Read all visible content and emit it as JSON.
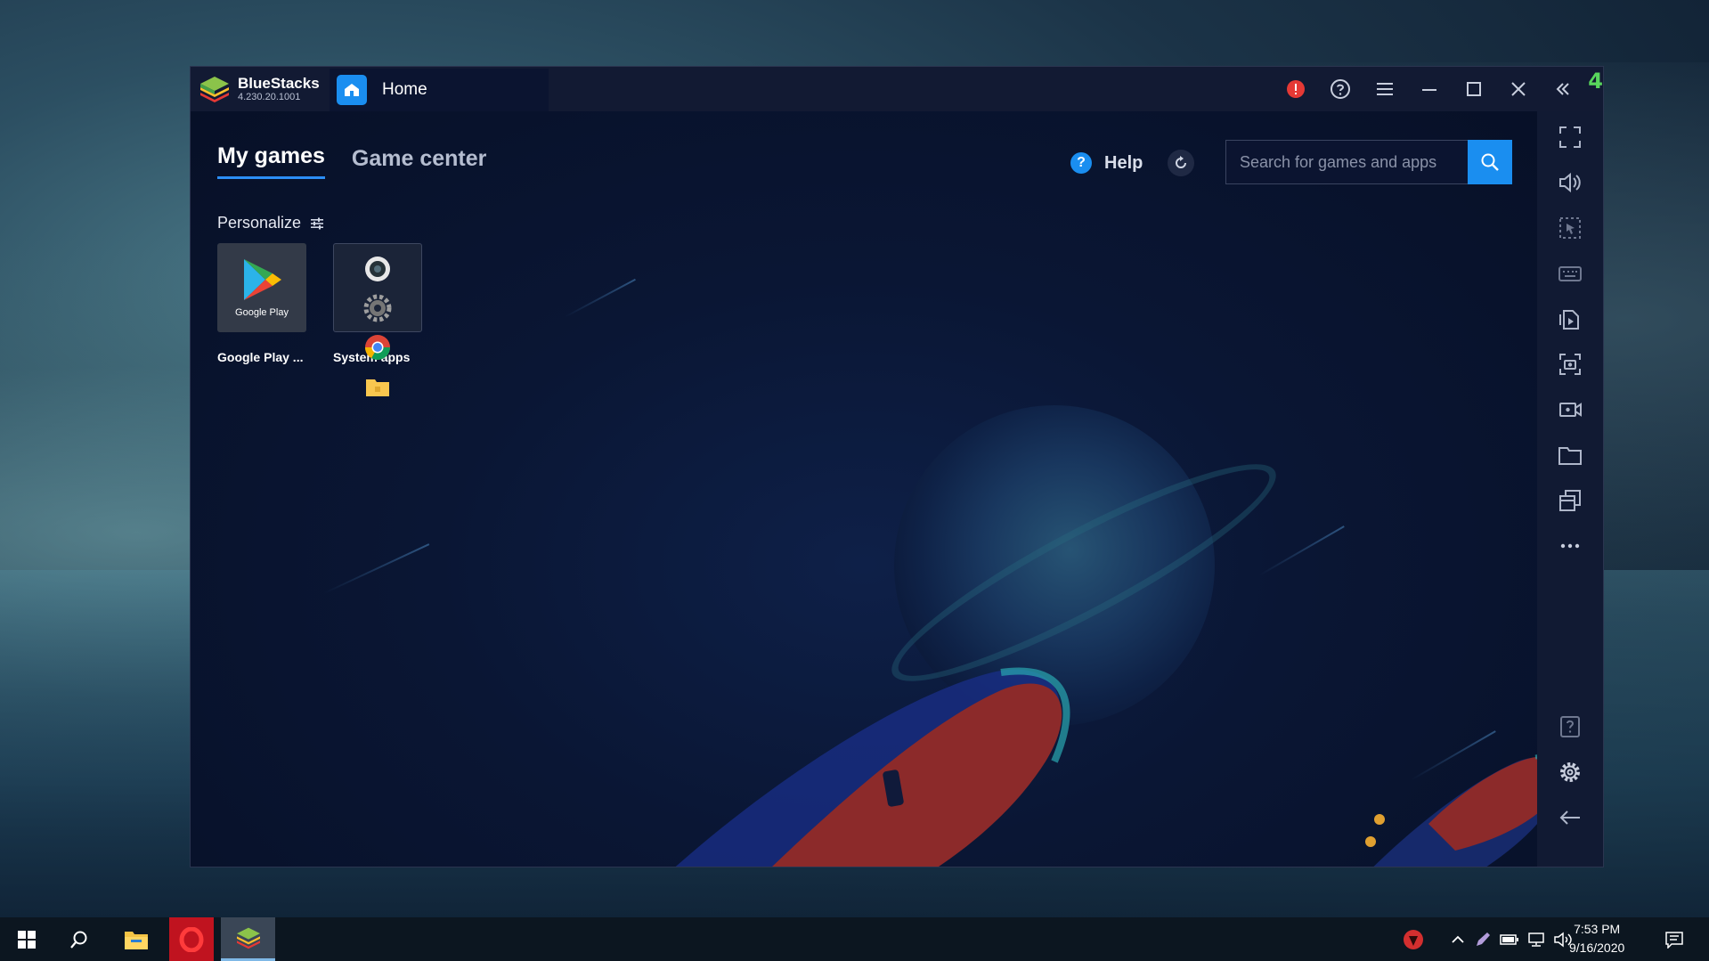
{
  "window": {
    "app_name": "BlueStacks",
    "version": "4.230.20.1001",
    "tab_label": "Home",
    "corner_mark": "4"
  },
  "tabs": [
    {
      "label": "My games",
      "active": true
    },
    {
      "label": "Game center",
      "active": false
    }
  ],
  "help": {
    "label": "Help"
  },
  "search": {
    "placeholder": "Search for games and apps"
  },
  "personalize": {
    "label": "Personalize"
  },
  "apps": [
    {
      "label": "Google Play ...",
      "tile_text": "Google Play"
    },
    {
      "label": "System apps"
    }
  ],
  "colors": {
    "accent": "#1a8ef0",
    "alert": "#e53935",
    "window_bg": "#0b1430",
    "titlebar_bg": "#121a33"
  },
  "title_controls": [
    "alert-icon",
    "help-circle-icon",
    "menu-icon",
    "minimize-icon",
    "maximize-icon",
    "close-icon",
    "collapse-sidebar-icon"
  ],
  "sidebar_icons": [
    "fullscreen-icon",
    "volume-icon",
    "pointer-select-icon",
    "keyboard-icon",
    "install-apk-icon",
    "screenshot-icon",
    "record-video-icon",
    "folder-icon",
    "multi-instance-icon",
    "more-icon",
    "help-icon",
    "settings-icon",
    "back-icon"
  ],
  "taskbar": {
    "time": "7:53 PM",
    "date": "9/16/2020"
  }
}
